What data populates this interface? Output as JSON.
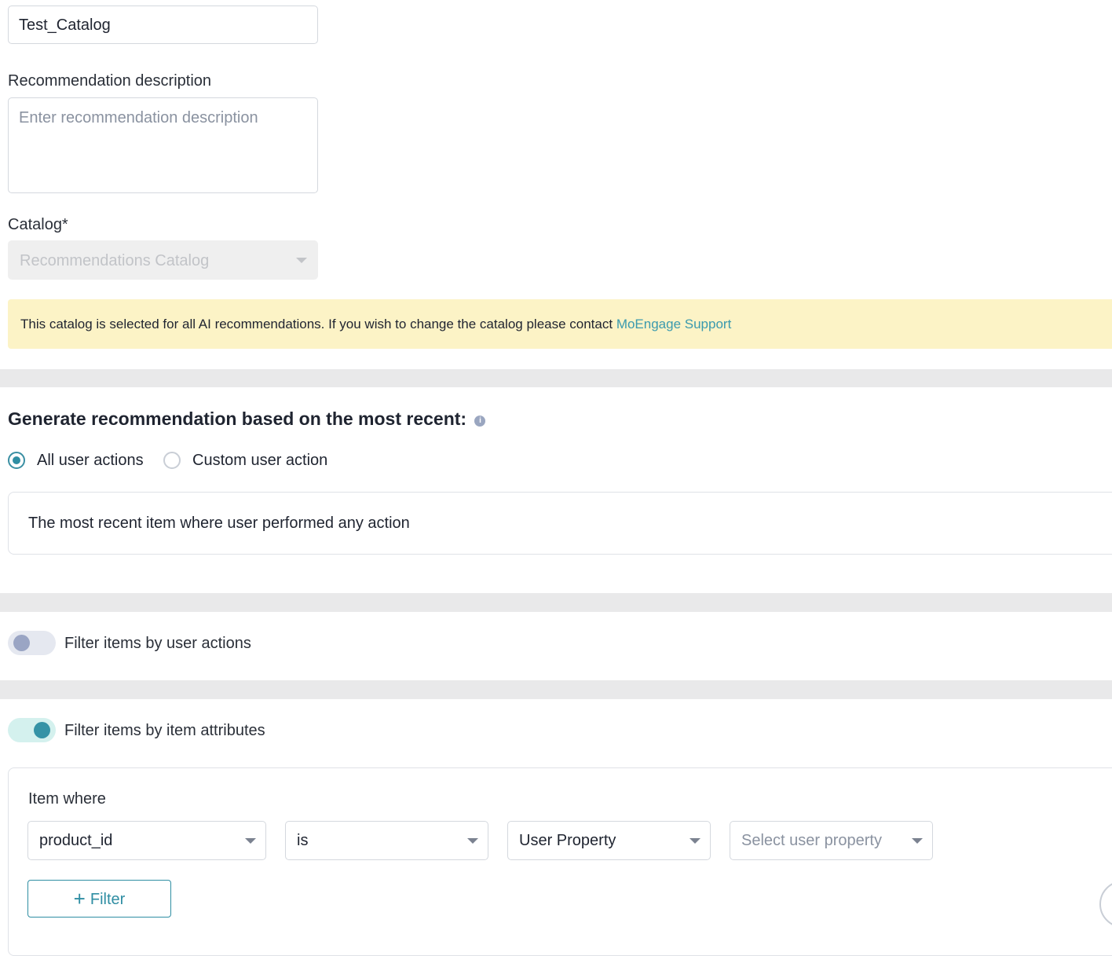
{
  "form": {
    "name_value": "Test_Catalog",
    "description_label": "Recommendation description",
    "description_placeholder": "Enter recommendation description",
    "catalog_label": "Catalog*",
    "catalog_value": "Recommendations Catalog"
  },
  "notice": {
    "text": "This catalog is selected for all AI recommendations. If you wish to change the catalog please contact ",
    "link": "MoEngage Support"
  },
  "generate": {
    "heading": "Generate recommendation based on the most recent:",
    "info_icon": "info-icon",
    "options": [
      "All user actions",
      "Custom user action"
    ],
    "selected": "All user actions",
    "summary": "The most recent item where user performed any action"
  },
  "filters": {
    "user_actions_label": "Filter items by user actions",
    "user_actions_enabled": false,
    "item_attributes_label": "Filter items by item attributes",
    "item_attributes_enabled": true
  },
  "item_filter": {
    "title": "Item where",
    "attribute": "product_id",
    "operator": "is",
    "value_type": "User Property",
    "value_placeholder": "Select user property",
    "add_filter_label": "Filter"
  },
  "colors": {
    "accent": "#2f8ea3",
    "notice_bg": "#fcf3c6",
    "link": "#3a9aae"
  }
}
